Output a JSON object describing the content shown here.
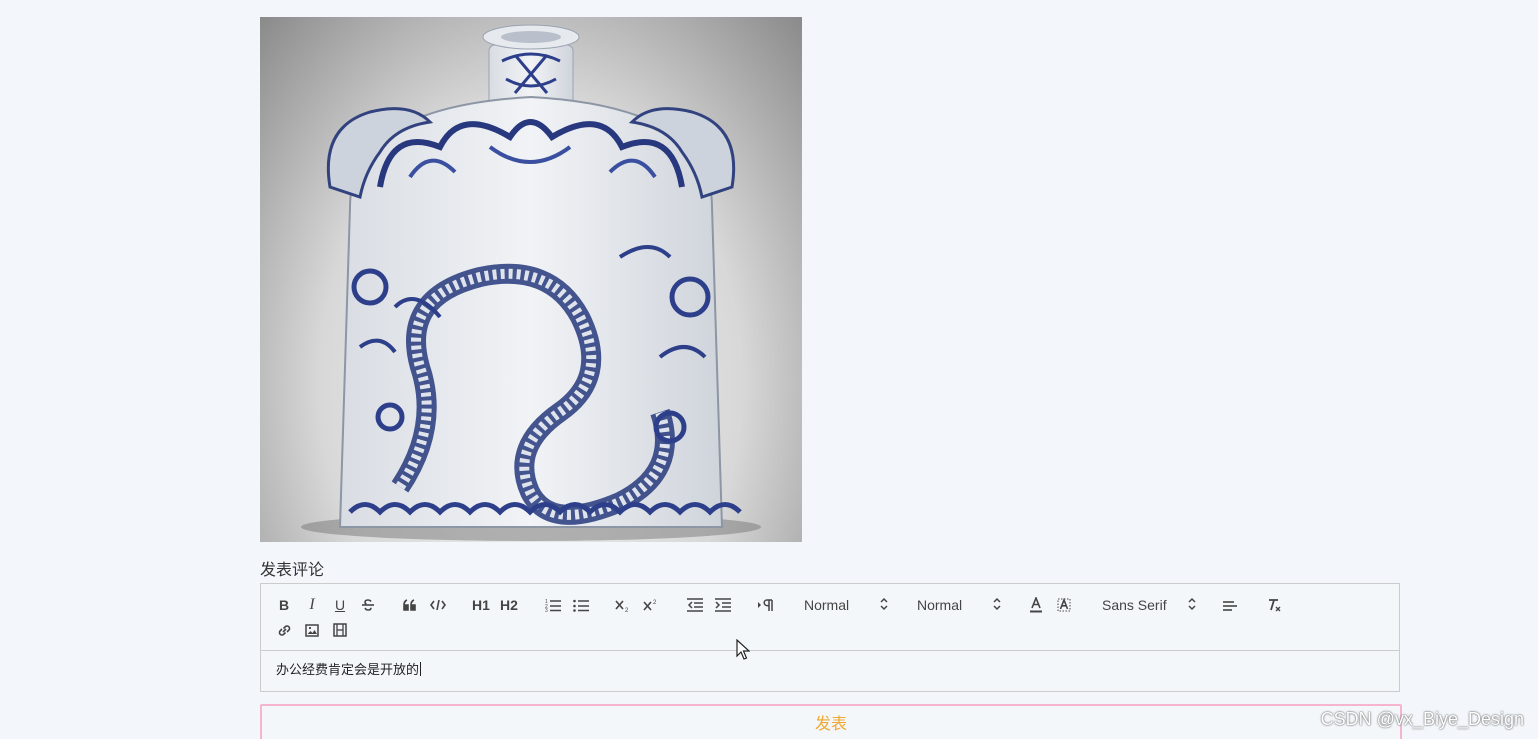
{
  "product": {
    "image_icon": "porcelain-flask-image"
  },
  "comment_section": {
    "title": "发表评论"
  },
  "editor": {
    "toolbar": {
      "header_size": "Normal",
      "font_size": "Normal",
      "font_family": "Sans Serif",
      "bold": "B",
      "italic": "I",
      "underline": "U",
      "h1": "H1",
      "h2": "H2"
    },
    "content": "办公经费肯定会是开放的"
  },
  "submit": {
    "label": "发表"
  },
  "watermark": {
    "text": "CSDN @vx_Biye_Design"
  }
}
